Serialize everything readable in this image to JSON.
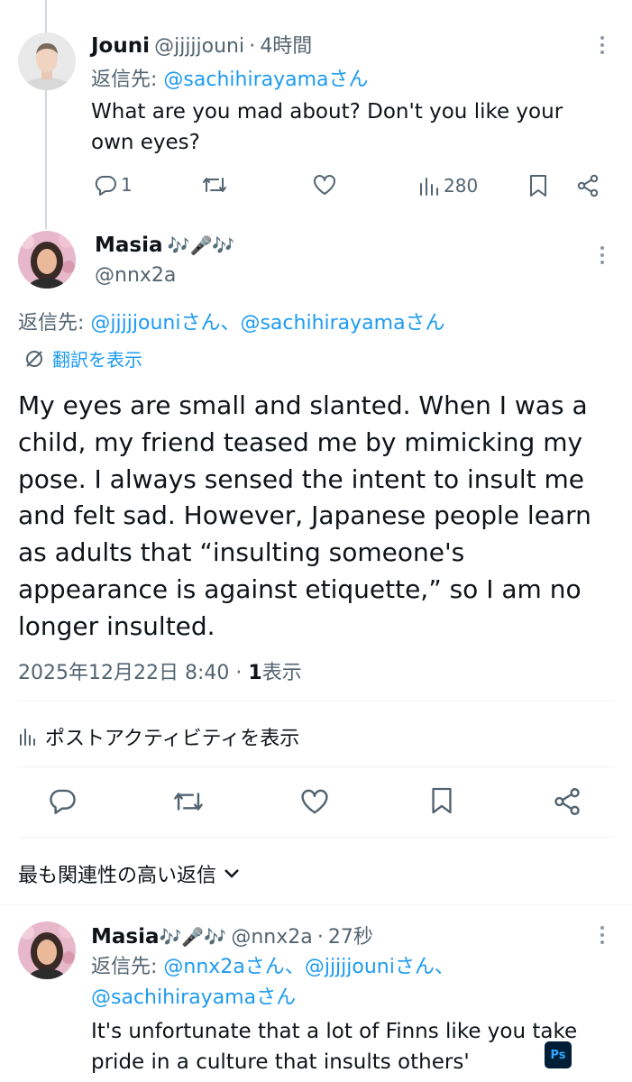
{
  "thread_reply": {
    "name": "Jouni",
    "handle": "@jjjjjouni",
    "separator": "·",
    "time": "4時間",
    "reply_to_label": "返信先:",
    "reply_to_mention": "@sachihirayamaさん",
    "text": "What are you mad about? Don't you like your own eyes?",
    "replies": "1",
    "views": "280"
  },
  "main_post": {
    "name": "Masia",
    "name_emojis": "🎶🎤🎶",
    "handle": "@nnx2a",
    "reply_to_label": "返信先:",
    "reply_to_mention_1": "@jjjjjouniさん",
    "reply_to_joiner": "、",
    "reply_to_mention_2": "@sachihirayamaさん",
    "translate_label": "翻訳を表示",
    "text": "My eyes are small and slanted. When I was a child, my friend teased me by mimicking my pose. I always sensed the intent to insult me and felt sad. However, Japanese people learn as adults that “insulting someone's appearance is against etiquette,” so I am no longer insulted.",
    "timestamp": "2025年12月22日 8:40",
    "separator": "·",
    "views_count": "1",
    "views_label": "表示",
    "activity_label": "ポストアクティビティを表示"
  },
  "replies_sort": {
    "label": "最も関連性の高い返信"
  },
  "reply": {
    "name": "Masia",
    "name_emojis": "🎶🎤🎶",
    "handle": "@nnx2a",
    "separator": "·",
    "time": "27秒",
    "reply_to_label": "返信先:",
    "reply_to_mention_1": "@nnx2aさん",
    "reply_to_joiner": "、",
    "reply_to_mention_2": "@jjjjjouniさん",
    "reply_to_mention_3": "@sachihirayamaさん",
    "text": "It's unfortunate that a lot of  Finns like you take pride in a culture that insults others'"
  },
  "overlay": {
    "badge": "Ps"
  },
  "icons": {
    "reply": "reply-icon",
    "retweet": "retweet-icon",
    "like": "heart-icon",
    "views": "bar-chart-icon",
    "bookmark": "bookmark-icon",
    "share": "share-icon",
    "more": "more-vertical-icon",
    "translate": "translate-icon",
    "chevron": "chevron-down-icon"
  },
  "colors": {
    "text": "#0f1419",
    "secondary": "#536471",
    "link": "#1d9bf0",
    "divider": "#eff3f4"
  }
}
